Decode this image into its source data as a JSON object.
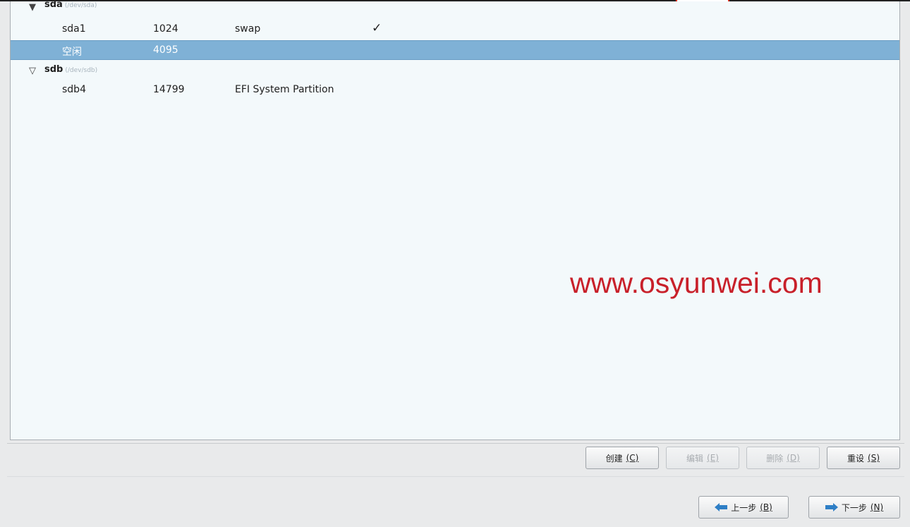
{
  "partition_tree": {
    "disks": [
      {
        "name": "sda",
        "path": "(/dev/sda)",
        "partitions": [
          {
            "name": "sda1",
            "size": "1024",
            "type": "swap",
            "format": "✓"
          },
          {
            "name": "空闲",
            "size": "4095",
            "type": "",
            "format": "",
            "selected": true
          }
        ]
      },
      {
        "name": "sdb",
        "path": "(/dev/sdb)",
        "partitions": [
          {
            "name": "sdb4",
            "size": "14799",
            "type": "EFI System Partition",
            "format": ""
          }
        ]
      }
    ]
  },
  "watermark": "www.osyunwei.com",
  "actions": {
    "create": {
      "label": "创建",
      "mnemonic": "(C)"
    },
    "edit": {
      "label": "编辑",
      "mnemonic": "(E)"
    },
    "delete": {
      "label": "删除",
      "mnemonic": "(D)"
    },
    "reset": {
      "label": "重设",
      "mnemonic": "(S)"
    }
  },
  "navigation": {
    "back": {
      "label": "上一步",
      "mnemonic": "(B)"
    },
    "next": {
      "label": "下一步",
      "mnemonic": "(N)"
    }
  },
  "colors": {
    "selection": "#7fb1d6",
    "watermark": "#c8202a",
    "arrow": "#2f7fc6",
    "annotation_mark": "#e03020"
  }
}
